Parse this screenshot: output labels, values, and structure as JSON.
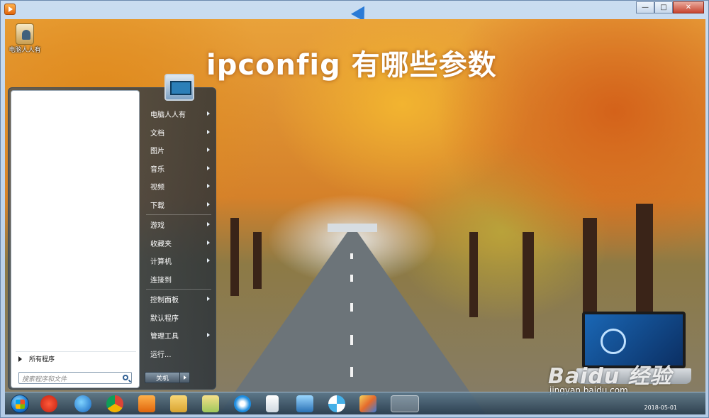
{
  "overlay_title": "ipconfig 有哪些参数",
  "desktop_icon": {
    "label": "电脑人人有"
  },
  "start_menu": {
    "right_items": [
      {
        "label": "电脑人人有",
        "submenu": true
      },
      {
        "label": "文档",
        "submenu": true
      },
      {
        "label": "图片",
        "submenu": true
      },
      {
        "label": "音乐",
        "submenu": true
      },
      {
        "label": "视频",
        "submenu": true
      },
      {
        "label": "下载",
        "submenu": true
      },
      {
        "label": "游戏",
        "submenu": true
      },
      {
        "label": "收藏夹",
        "submenu": true
      },
      {
        "label": "计算机",
        "submenu": true
      },
      {
        "label": "连接到",
        "submenu": false
      },
      {
        "label": "控制面板",
        "submenu": true
      },
      {
        "label": "默认程序",
        "submenu": false
      },
      {
        "label": "管理工具",
        "submenu": true
      },
      {
        "label": "运行...",
        "submenu": false
      }
    ],
    "all_programs": "所有程序",
    "search_placeholder": "搜索程序和文件",
    "shutdown_label": "关机"
  },
  "watermark": {
    "brand": "Baidu 经验",
    "url": "jingyan.baidu.com"
  },
  "taskbar": {
    "date": "2018-05-01",
    "icons": [
      "windows-start-icon",
      "jiang-app-icon",
      "internet-explorer-icon",
      "chrome-icon",
      "media-player-icon",
      "file-explorer-icon",
      "folder-icon",
      "blue-drop-icon",
      "document-icon",
      "remote-desktop-icon",
      "pinwheel-icon",
      "paint-icon",
      "game-icon"
    ]
  },
  "colors": {
    "titlebar": "#c9dcf0",
    "close_button": "#c7442f",
    "taskbar": "#283c4e"
  }
}
